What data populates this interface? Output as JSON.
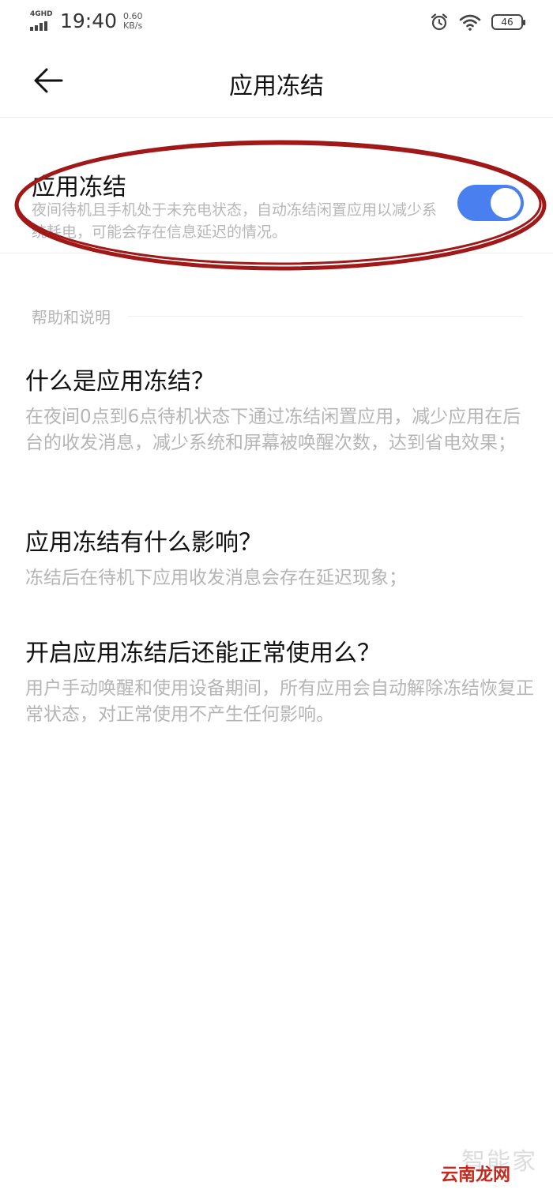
{
  "status_bar": {
    "network": "4GHD",
    "time": "19:40",
    "speed_value": "0.60",
    "speed_unit": "KB/s",
    "battery": "46",
    "icons": [
      "signal-icon",
      "alarm-icon",
      "wifi-icon",
      "battery-icon"
    ]
  },
  "header": {
    "title": "应用冻结",
    "back_icon": "arrow-left-icon"
  },
  "freeze_setting": {
    "title": "应用冻结",
    "description": "夜间待机且手机处于未充电状态，自动冻结闲置应用以减少系统耗电，可能会存在信息延迟的情况。",
    "enabled": true,
    "switch_color": "#4a7ff0"
  },
  "annotation": {
    "color": "#a01818"
  },
  "help": {
    "section_label": "帮助和说明",
    "items": [
      {
        "question": "什么是应用冻结？",
        "answer": "在夜间0点到6点待机状态下通过冻结闲置应用，减少应用在后台的收发消息，减少系统和屏幕被唤醒次数，达到省电效果；"
      },
      {
        "question": "应用冻结有什么影响？",
        "answer": "冻结后在待机下应用收发消息会存在延迟现象；"
      },
      {
        "question": "开启应用冻结后还能正常使用么？",
        "answer": "用户手动唤醒和使用设备期间，所有应用会自动解除冻结恢复正常状态，对正常使用不产生任何影响。"
      }
    ]
  },
  "watermark": {
    "top_text": "智能家",
    "bottom_text": "云南龙网"
  }
}
